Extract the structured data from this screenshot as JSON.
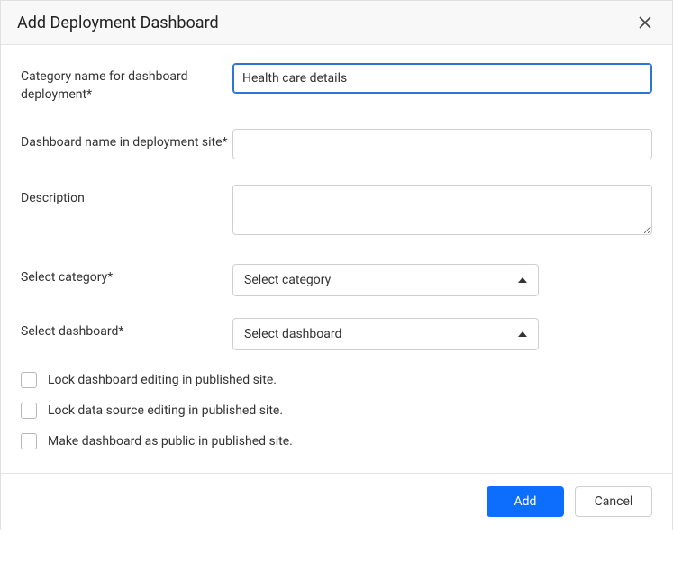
{
  "dialog": {
    "title": "Add Deployment Dashboard"
  },
  "form": {
    "categoryName": {
      "label": "Category name for dashboard deployment*",
      "value": "Health care details"
    },
    "dashboardName": {
      "label": "Dashboard name in deployment site*",
      "value": ""
    },
    "description": {
      "label": "Description",
      "value": ""
    },
    "selectCategory": {
      "label": "Select category*",
      "placeholder": "Select category"
    },
    "selectDashboard": {
      "label": "Select dashboard*",
      "placeholder": "Select dashboard"
    }
  },
  "checkboxes": {
    "lockDashboard": {
      "label": "Lock dashboard editing in published site.",
      "checked": false
    },
    "lockDataSource": {
      "label": "Lock data source editing in published site.",
      "checked": false
    },
    "makePublic": {
      "label": "Make dashboard as public in published site.",
      "checked": false
    }
  },
  "footer": {
    "primary": "Add",
    "secondary": "Cancel"
  }
}
